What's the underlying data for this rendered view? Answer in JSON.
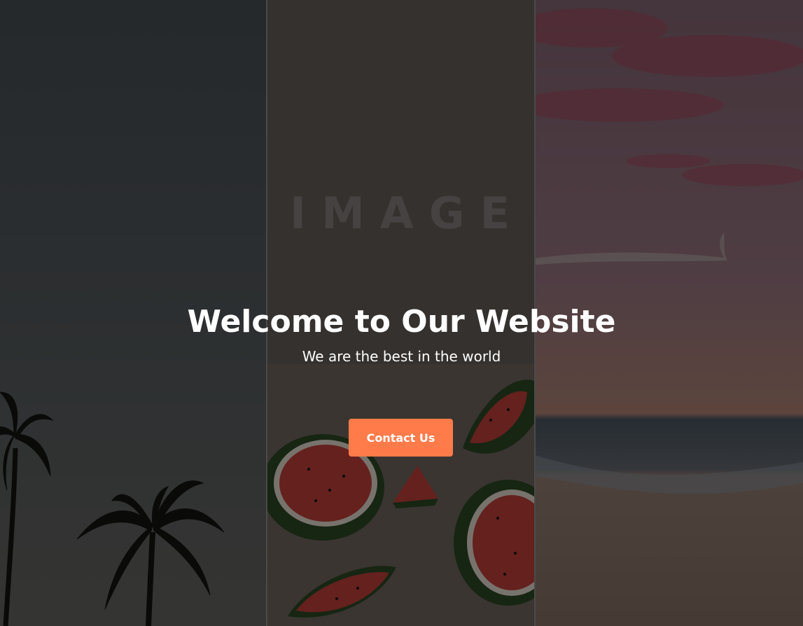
{
  "hero": {
    "watermark": "IMAGE",
    "title": "Welcome to Our Website",
    "subtitle": "We are the best in the world",
    "cta_label": "Contact Us"
  },
  "colors": {
    "accent": "#ff7b4a",
    "overlay": "rgba(0,0,0,0.5)",
    "text": "#ffffff"
  },
  "images": [
    {
      "name": "palm-trees-image"
    },
    {
      "name": "watermelon-image"
    },
    {
      "name": "beach-sunset-image"
    }
  ]
}
